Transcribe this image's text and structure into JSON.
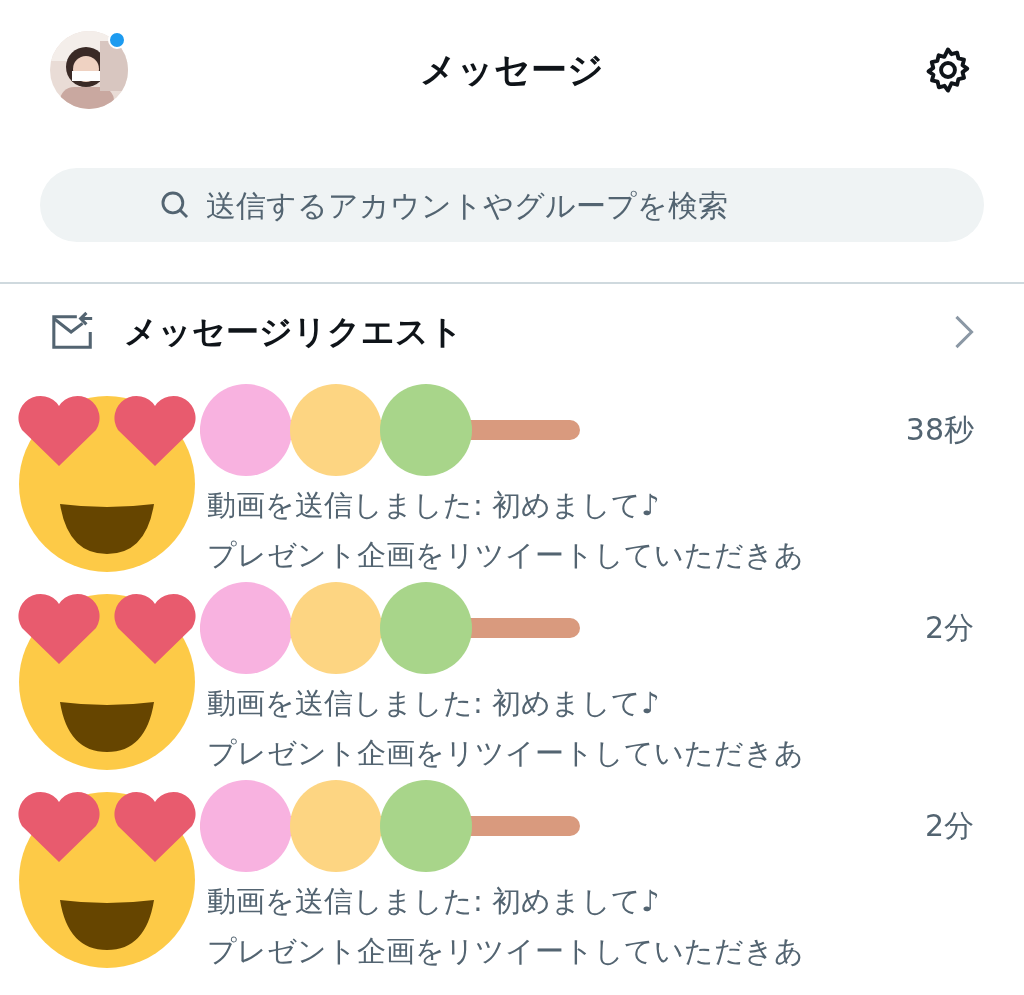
{
  "header": {
    "title": "メッセージ",
    "has_unread_badge": true
  },
  "search": {
    "placeholder": "送信するアカウントやグループを検索"
  },
  "message_requests": {
    "label": "メッセージリクエスト"
  },
  "conversations": [
    {
      "time": "38秒",
      "preview": [
        "動画を送信しました: 初めまして♪",
        "プレゼント企画をリツイートしていただきあ"
      ]
    },
    {
      "time": "2分",
      "preview": [
        "動画を送信しました: 初めまして♪",
        "プレゼント企画をリツイートしていただきあ"
      ]
    },
    {
      "time": "2分",
      "preview": [
        "動画を送信しました: 初めまして♪",
        "プレゼント企画をリツイートしていただきあ"
      ]
    }
  ]
}
